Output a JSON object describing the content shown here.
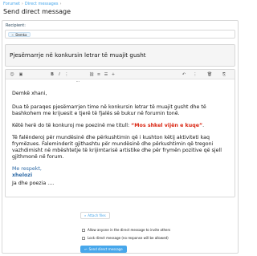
{
  "breadcrumb": {
    "items": [
      "Forumet",
      "Direct messages"
    ],
    "separator": "›"
  },
  "page_title": "Send direct message",
  "recipient": {
    "label": "Recipient:",
    "chips": [
      {
        "remove": "×",
        "name": "Demka"
      }
    ]
  },
  "title_field": {
    "value": "Pjesëmarrje në konkursin letrar të muajit gusht"
  },
  "toolbar": {
    "icons": [
      "smile-icon",
      "image-icon",
      "bold-icon",
      "italic-icon",
      "more-text-icon",
      "link-icon",
      "align-icon",
      "list-icon",
      "insert-icon",
      "undo-icon",
      "vertical-dots-icon",
      "delete-icon",
      "preview-icon",
      "settings-icon"
    ],
    "glyphs": [
      "☺",
      "▣",
      "B",
      "I",
      "⋮",
      "⛓",
      "≡",
      "☰",
      "+",
      "↶",
      "⋮",
      "🗑",
      "⎘",
      "⋯"
    ]
  },
  "message": {
    "greeting": "Demkë xhani,",
    "p1": "Dua të paraqes pjesëmarrjen time në konkursin letrar të muajit gusht dhe të bashkohem me krijuesit e tjerë të fjalës së bukur në forumin tonë.",
    "p2_pre": "Këtë herë do të konkuroj me poezinë me titull: ",
    "poem_title": "“Mos shkel vijën e kuqe”",
    "p2_post": ".",
    "p3": "Të falënderoj për mundësinë dhe përkushtimin që i kushton këtij aktiviteti kaq frymëzues. Faleminderit gjithashtu për mundësinë dhe përkushtimin që tregoni vazhdimisht në mbështetje të krijimtarisë artistike dhe për frymën pozitive që sjell gjithmonë në forum.",
    "sign_off": "Me respekt,",
    "signature": "xhelozi",
    "closing": "Ja dhe poezia ...."
  },
  "attach": {
    "icon": "paperclip-icon",
    "label": "Attach files"
  },
  "options": [
    {
      "label": "Allow anyone in the direct message to invite others",
      "checked": false
    },
    {
      "label": "Lock direct message (no response will be allowed)",
      "checked": false
    }
  ],
  "send_button": {
    "icon": "reply-icon",
    "label": "Send direct message"
  },
  "colors": {
    "link": "#47a7eb",
    "button": "#47a7eb",
    "poem_title": "#d9230f",
    "signature": "#2e6aa6"
  }
}
